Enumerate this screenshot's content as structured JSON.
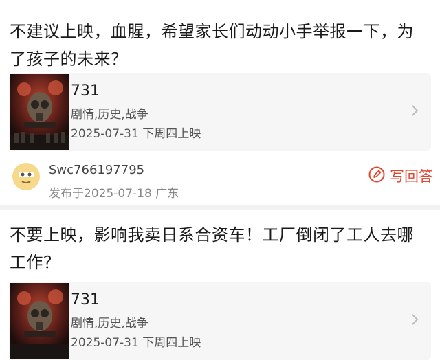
{
  "posts": [
    {
      "question": "不建议上映，血腥，希望家长们动动小手举报一下，为了孩子的未来？",
      "movie": {
        "title": "731",
        "genres": "剧情,历史,战争",
        "release": "2025-07-31 下周四上映"
      }
    },
    {
      "question": "不要上映，影响我卖日系合资车！工厂倒闭了工人去哪工作？",
      "movie": {
        "title": "731",
        "genres": "剧情,历史,战争",
        "release": "2025-07-31 下周四上映"
      }
    }
  ],
  "author": {
    "username": "Swc766197795",
    "posted": "发布于2025-07-18  广东"
  },
  "actions": {
    "write_answer": "写回答"
  },
  "icons": {
    "write": "pencil-circle-icon",
    "chevron": "chevron-right-icon",
    "avatar": "cartoon-avatar-icon"
  },
  "colors": {
    "accent": "#e0452f",
    "card_bg": "#f6f6f6",
    "divider": "#f2f2f2"
  }
}
